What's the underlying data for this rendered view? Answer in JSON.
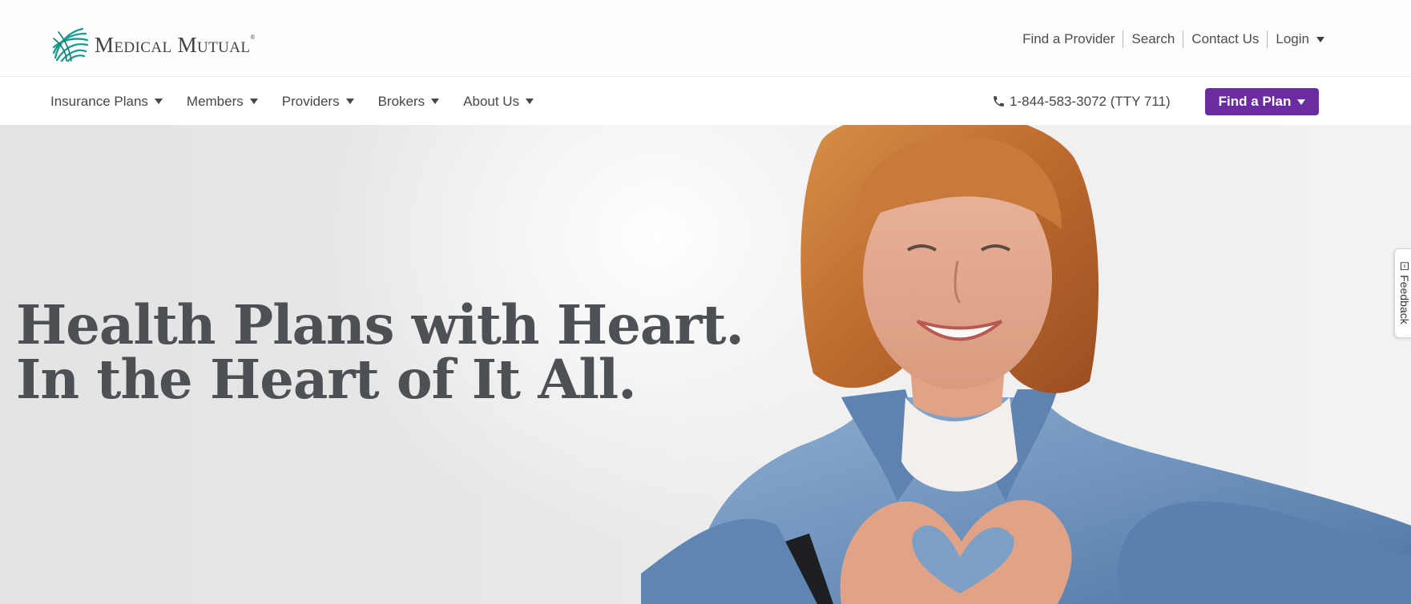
{
  "brand": {
    "name": "Medical Mutual",
    "reg": "®",
    "accent": "#1b9b8f",
    "primary_button": "#6a2ca0"
  },
  "utility_nav": {
    "find_provider": "Find a Provider",
    "search": "Search",
    "contact": "Contact Us",
    "login": "Login"
  },
  "main_nav": {
    "items": [
      {
        "label": "Insurance Plans"
      },
      {
        "label": "Members"
      },
      {
        "label": "Providers"
      },
      {
        "label": "Brokers"
      },
      {
        "label": "About Us"
      }
    ],
    "phone": "1-844-583-3072 (TTY 711)",
    "find_plan": "Find a Plan"
  },
  "hero": {
    "line1": "Health Plans with Heart.",
    "line2": "In the Heart of It All."
  },
  "feedback": {
    "label": "Feedback"
  },
  "icons": [
    "logo-mark-icon",
    "caret-down-icon",
    "phone-icon",
    "feedback-icon"
  ]
}
